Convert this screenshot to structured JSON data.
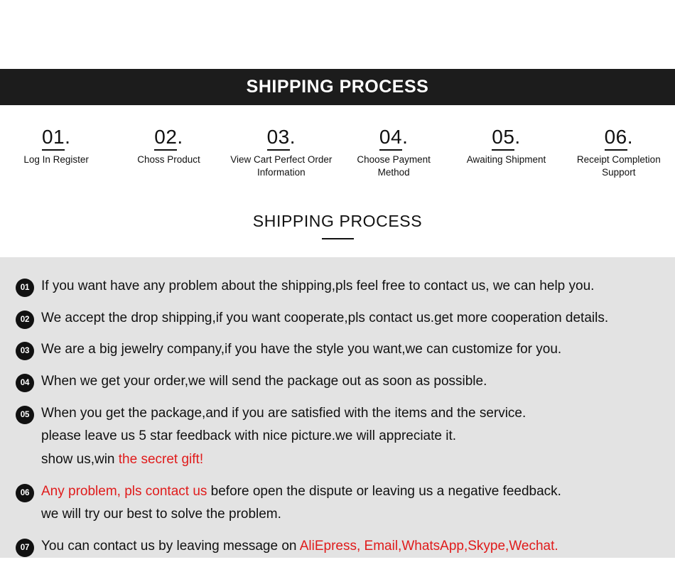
{
  "banner": {
    "title": "SHIPPING PROCESS"
  },
  "steps": [
    {
      "number": "01",
      "dot": ".",
      "label": "Log In Register"
    },
    {
      "number": "02",
      "dot": ".",
      "label": "Choss Product"
    },
    {
      "number": "03",
      "dot": ".",
      "label": "View Cart Perfect Order Information"
    },
    {
      "number": "04",
      "dot": ".",
      "label": "Choose Payment Method"
    },
    {
      "number": "05",
      "dot": ".",
      "label": "Awaiting Shipment"
    },
    {
      "number": "06",
      "dot": ".",
      "label": "Receipt Completion Support"
    }
  ],
  "subheading": {
    "title": "SHIPPING PROCESS"
  },
  "notes": [
    {
      "badge": "01",
      "lines": [
        [
          {
            "text": "If you want have any problem about the shipping,pls feel free to contact us, we can help you.",
            "color": "black"
          }
        ]
      ]
    },
    {
      "badge": "02",
      "lines": [
        [
          {
            "text": "We accept the drop shipping,if you want cooperate,pls contact us.get more cooperation details.",
            "color": "black"
          }
        ]
      ]
    },
    {
      "badge": "03",
      "lines": [
        [
          {
            "text": "We are a big jewelry company,if you have the style you want,we can customize for you.",
            "color": "black"
          }
        ]
      ]
    },
    {
      "badge": "04",
      "lines": [
        [
          {
            "text": "When we get your order,we will send the package out as soon as possible.",
            "color": "black"
          }
        ]
      ]
    },
    {
      "badge": "05",
      "lines": [
        [
          {
            "text": "When you get the package,and if you are satisfied with the items and the service.",
            "color": "black"
          }
        ],
        [
          {
            "text": "please leave us 5 star feedback with nice picture.we will appreciate it.",
            "color": "black"
          }
        ],
        [
          {
            "text": "show us,win ",
            "color": "black"
          },
          {
            "text": "the secret gift!",
            "color": "red"
          }
        ]
      ]
    },
    {
      "badge": "06",
      "lines": [
        [
          {
            "text": "Any problem, pls contact us",
            "color": "red"
          },
          {
            "text": " before open the dispute or leaving us a negative feedback.",
            "color": "black"
          }
        ],
        [
          {
            "text": "we will try our best to solve the problem.",
            "color": "black"
          }
        ]
      ]
    },
    {
      "badge": "07",
      "lines": [
        [
          {
            "text": "You can contact us by leaving message on ",
            "color": "black"
          },
          {
            "text": "AliEpress, Email,WhatsApp,Skype,Wechat.",
            "color": "red"
          }
        ]
      ]
    }
  ],
  "colors": {
    "banner_bg": "#1c1c1c",
    "panel_bg": "#e3e3e3",
    "text": "#111111",
    "accent_red": "#e01b1b"
  }
}
